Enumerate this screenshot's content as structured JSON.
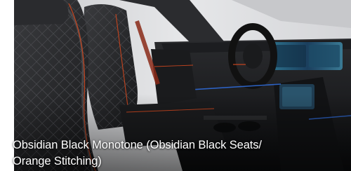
{
  "image": {
    "subject": "Vehicle interior front cabin view",
    "caption_lines": [
      "Obsidian Black Monotone (Obsidian Black Seats/",
      "Orange Stitching)"
    ]
  },
  "colors": {
    "seat_leather": "#1f2022",
    "stitching_accent": "#c2441f",
    "background_light": "#dcdde0",
    "dashboard": "#151618",
    "ambient_light": "#2f6bd8",
    "caption_text": "#ffffff"
  }
}
